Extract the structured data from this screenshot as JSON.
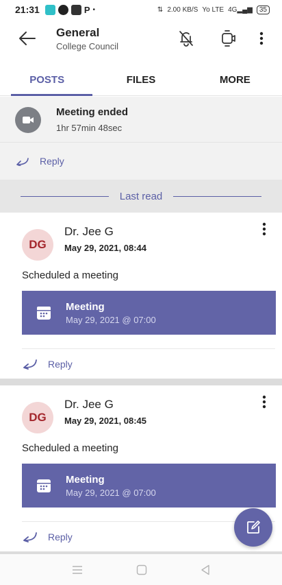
{
  "status_bar": {
    "time": "21:31",
    "network_speed": "2.00",
    "network_unit": "KB/S",
    "volte": "Yo LTE",
    "signal": "4G",
    "battery": "35"
  },
  "header": {
    "title": "General",
    "subtitle": "College Council",
    "icons": [
      "back-arrow-icon",
      "notifications-off-icon",
      "video-call-icon",
      "more-vertical-icon"
    ]
  },
  "tabs": [
    {
      "label": "POSTS",
      "active": true
    },
    {
      "label": "FILES",
      "active": false
    },
    {
      "label": "MORE",
      "active": false
    }
  ],
  "previous_post": {
    "title": "Meeting ended",
    "duration": "1hr 57min 48sec",
    "reply_label": "Reply"
  },
  "divider": {
    "label": "Last read"
  },
  "posts": [
    {
      "avatar_initials": "DG",
      "author": "Dr. Jee G",
      "timestamp": "May 29, 2021, 08:44",
      "text": "Scheduled a meeting",
      "meeting_title": "Meeting",
      "meeting_time": "May 29, 2021 @ 07:00",
      "reply_label": "Reply"
    },
    {
      "avatar_initials": "DG",
      "author": "Dr. Jee G",
      "timestamp": "May 29, 2021, 08:45",
      "text": "Scheduled a meeting",
      "meeting_title": "Meeting",
      "meeting_time": "May 29, 2021 @ 07:00",
      "reply_label": "Reply"
    }
  ],
  "colors": {
    "brand": "#6264a7",
    "accent_text": "#5b5fa6",
    "avatar_bg": "#f3d6d6",
    "avatar_text": "#a4262c"
  }
}
